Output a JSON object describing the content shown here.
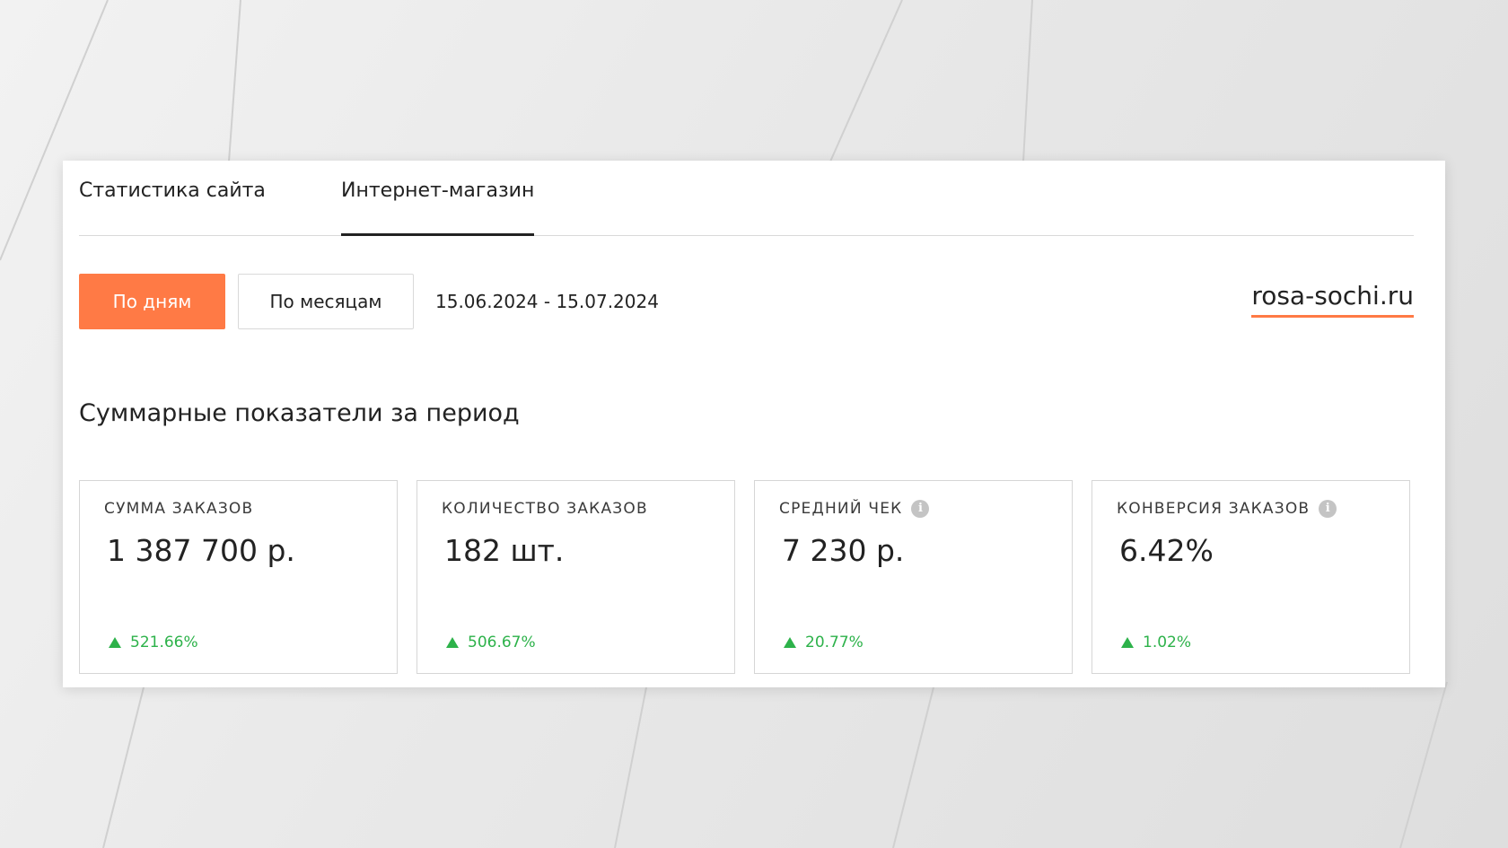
{
  "tabs": [
    {
      "label": "Статистика сайта",
      "active": false
    },
    {
      "label": "Интернет-магазин",
      "active": true
    }
  ],
  "controls": {
    "by_days_label": "По дням",
    "by_months_label": "По месяцам",
    "date_range": "15.06.2024 - 15.07.2024",
    "site_name": "rosa-sochi.ru"
  },
  "section": {
    "title": "Суммарные показатели за период"
  },
  "cards": [
    {
      "label": "СУММА ЗАКАЗОВ",
      "value": "1 387 700 р.",
      "change": "521.66%",
      "info": false
    },
    {
      "label": "КОЛИЧЕСТВО ЗАКАЗОВ",
      "value": "182 шт.",
      "change": "506.67%",
      "info": false
    },
    {
      "label": "СРЕДНИЙ ЧЕК",
      "value": "7 230 р.",
      "change": "20.77%",
      "info": true
    },
    {
      "label": "КОНВЕРСИЯ ЗАКАЗОВ",
      "value": "6.42%",
      "change": "1.02%",
      "info": true
    }
  ],
  "icons": {
    "info": "info-icon",
    "trend": "arrow-up-icon"
  },
  "colors": {
    "accent": "#ff7a45",
    "positive": "#2db24a"
  }
}
